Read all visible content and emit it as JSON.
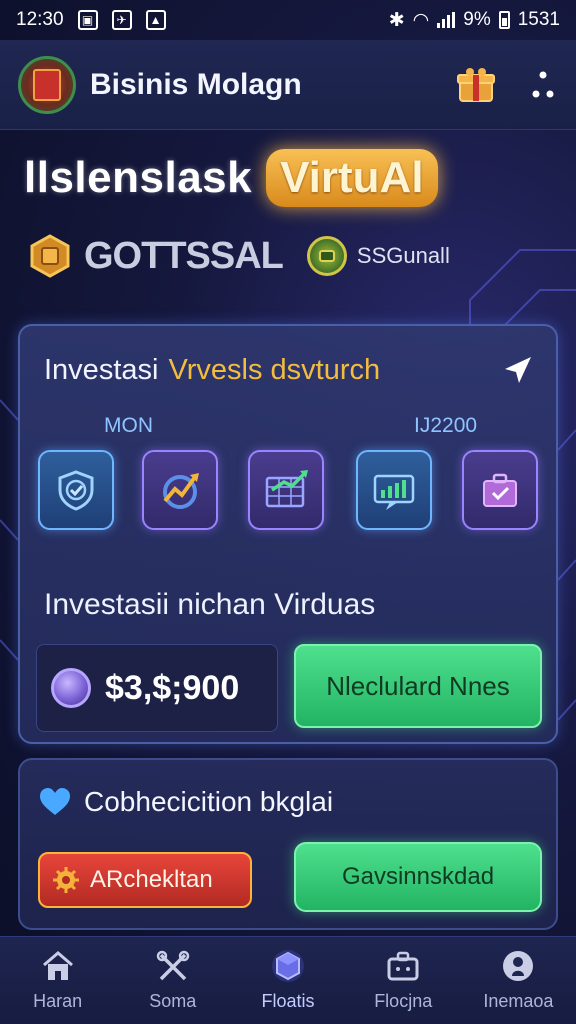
{
  "status_bar": {
    "time": "12:30",
    "battery": "9%",
    "clock_right": "1531"
  },
  "header": {
    "title": "Bisinis Molagn"
  },
  "hero": {
    "title": "llslenslask",
    "pill": "VirtuAl"
  },
  "brand": {
    "name": "GOTTSSAL",
    "sub": "SSGunall"
  },
  "investment": {
    "heading_white": "Investasi",
    "heading_gold": "Vrvesls dsvturch",
    "label_left": "MON",
    "label_right": "IJ2200",
    "tiles": [
      {
        "icon": "shield-check-icon",
        "style": "blue"
      },
      {
        "icon": "growth-arrow-icon",
        "style": "purple"
      },
      {
        "icon": "spreadsheet-chart-icon",
        "style": "purple"
      },
      {
        "icon": "bar-chart-icon",
        "style": "blue"
      },
      {
        "icon": "briefcase-check-icon",
        "style": "purple"
      }
    ],
    "section_title": "Investasii nichan Virduas",
    "amount": "$3,$;900",
    "action_label": "Nleclulard Nnes"
  },
  "card2": {
    "title": "Cobhecicition bkglai",
    "red_button": "ARchekltan",
    "green_button": "Gavsinnskdad"
  },
  "nav": {
    "items": [
      {
        "label": "Haran",
        "icon": "home-icon"
      },
      {
        "label": "Soma",
        "icon": "tools-icon"
      },
      {
        "label": "Floatis",
        "icon": "cube-icon"
      },
      {
        "label": "Flocjna",
        "icon": "briefcase-icon"
      },
      {
        "label": "Inemaoa",
        "icon": "profile-icon"
      }
    ],
    "active_index": 2
  },
  "colors": {
    "gold_accent": "#f2bd3f",
    "green_button": "#22b463",
    "red_button": "#b22a23",
    "tile_blue": "#6fb6ff",
    "tile_purple": "#9a84ff"
  }
}
